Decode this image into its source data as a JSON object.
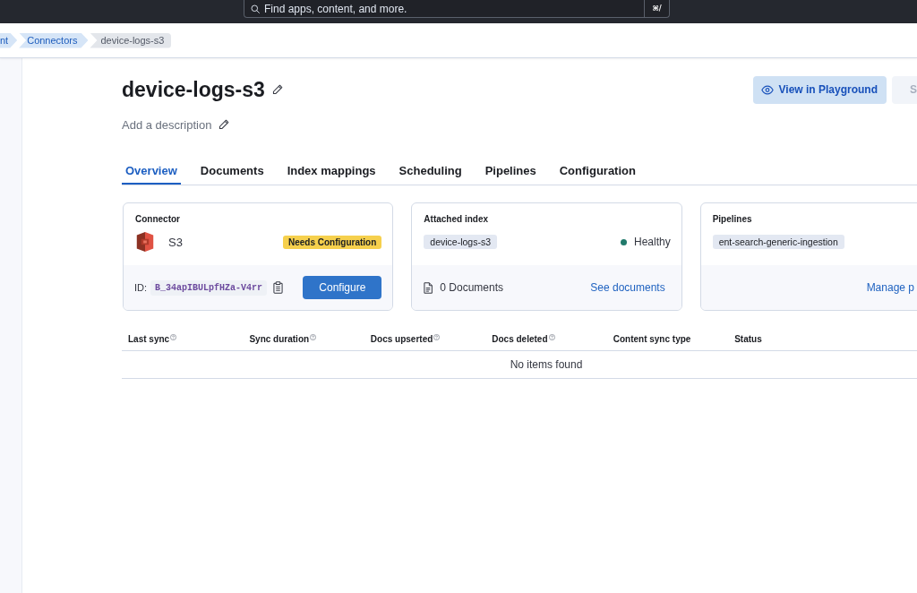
{
  "header": {
    "search": {
      "placeholder": "Find apps, content, and more.",
      "shortcut": "⌘/"
    }
  },
  "breadcrumbs": [
    {
      "label": "nt",
      "current": false
    },
    {
      "label": "Connectors",
      "current": false
    },
    {
      "label": "device-logs-s3",
      "current": true
    }
  ],
  "page": {
    "title": "device-logs-s3",
    "description_hint": "Add a description",
    "actions": [
      {
        "label": "View in Playground",
        "disabled": false
      },
      {
        "label": "S",
        "disabled": true
      }
    ]
  },
  "tabs": [
    {
      "label": "Overview",
      "selected": true
    },
    {
      "label": "Documents",
      "selected": false
    },
    {
      "label": "Index mappings",
      "selected": false
    },
    {
      "label": "Scheduling",
      "selected": false
    },
    {
      "label": "Pipelines",
      "selected": false
    },
    {
      "label": "Configuration",
      "selected": false
    }
  ],
  "cards": [
    {
      "kind": "connector",
      "title": "Connector",
      "name": "S3",
      "badge": "Needs Configuration",
      "id_label": "ID:",
      "id_value": "B_34apIBULpfHZa-V4rr",
      "button": "Configure"
    },
    {
      "kind": "index",
      "title": "Attached index",
      "tag": "device-logs-s3",
      "health": {
        "label": "Healthy",
        "color": "#217a6b"
      },
      "documents": "0 Documents",
      "link": "See documents"
    },
    {
      "kind": "pipelines",
      "title": "Pipelines",
      "tag": "ent-search-generic-ingestion",
      "link": "Manage p"
    }
  ],
  "table": {
    "columns": [
      {
        "label": "Last sync",
        "help": true
      },
      {
        "label": "Sync duration",
        "help": true
      },
      {
        "label": "Docs upserted",
        "help": true
      },
      {
        "label": "Docs deleted",
        "help": true
      },
      {
        "label": "Content sync type",
        "help": false
      },
      {
        "label": "Status",
        "help": false
      }
    ],
    "empty_message": "No items found"
  }
}
